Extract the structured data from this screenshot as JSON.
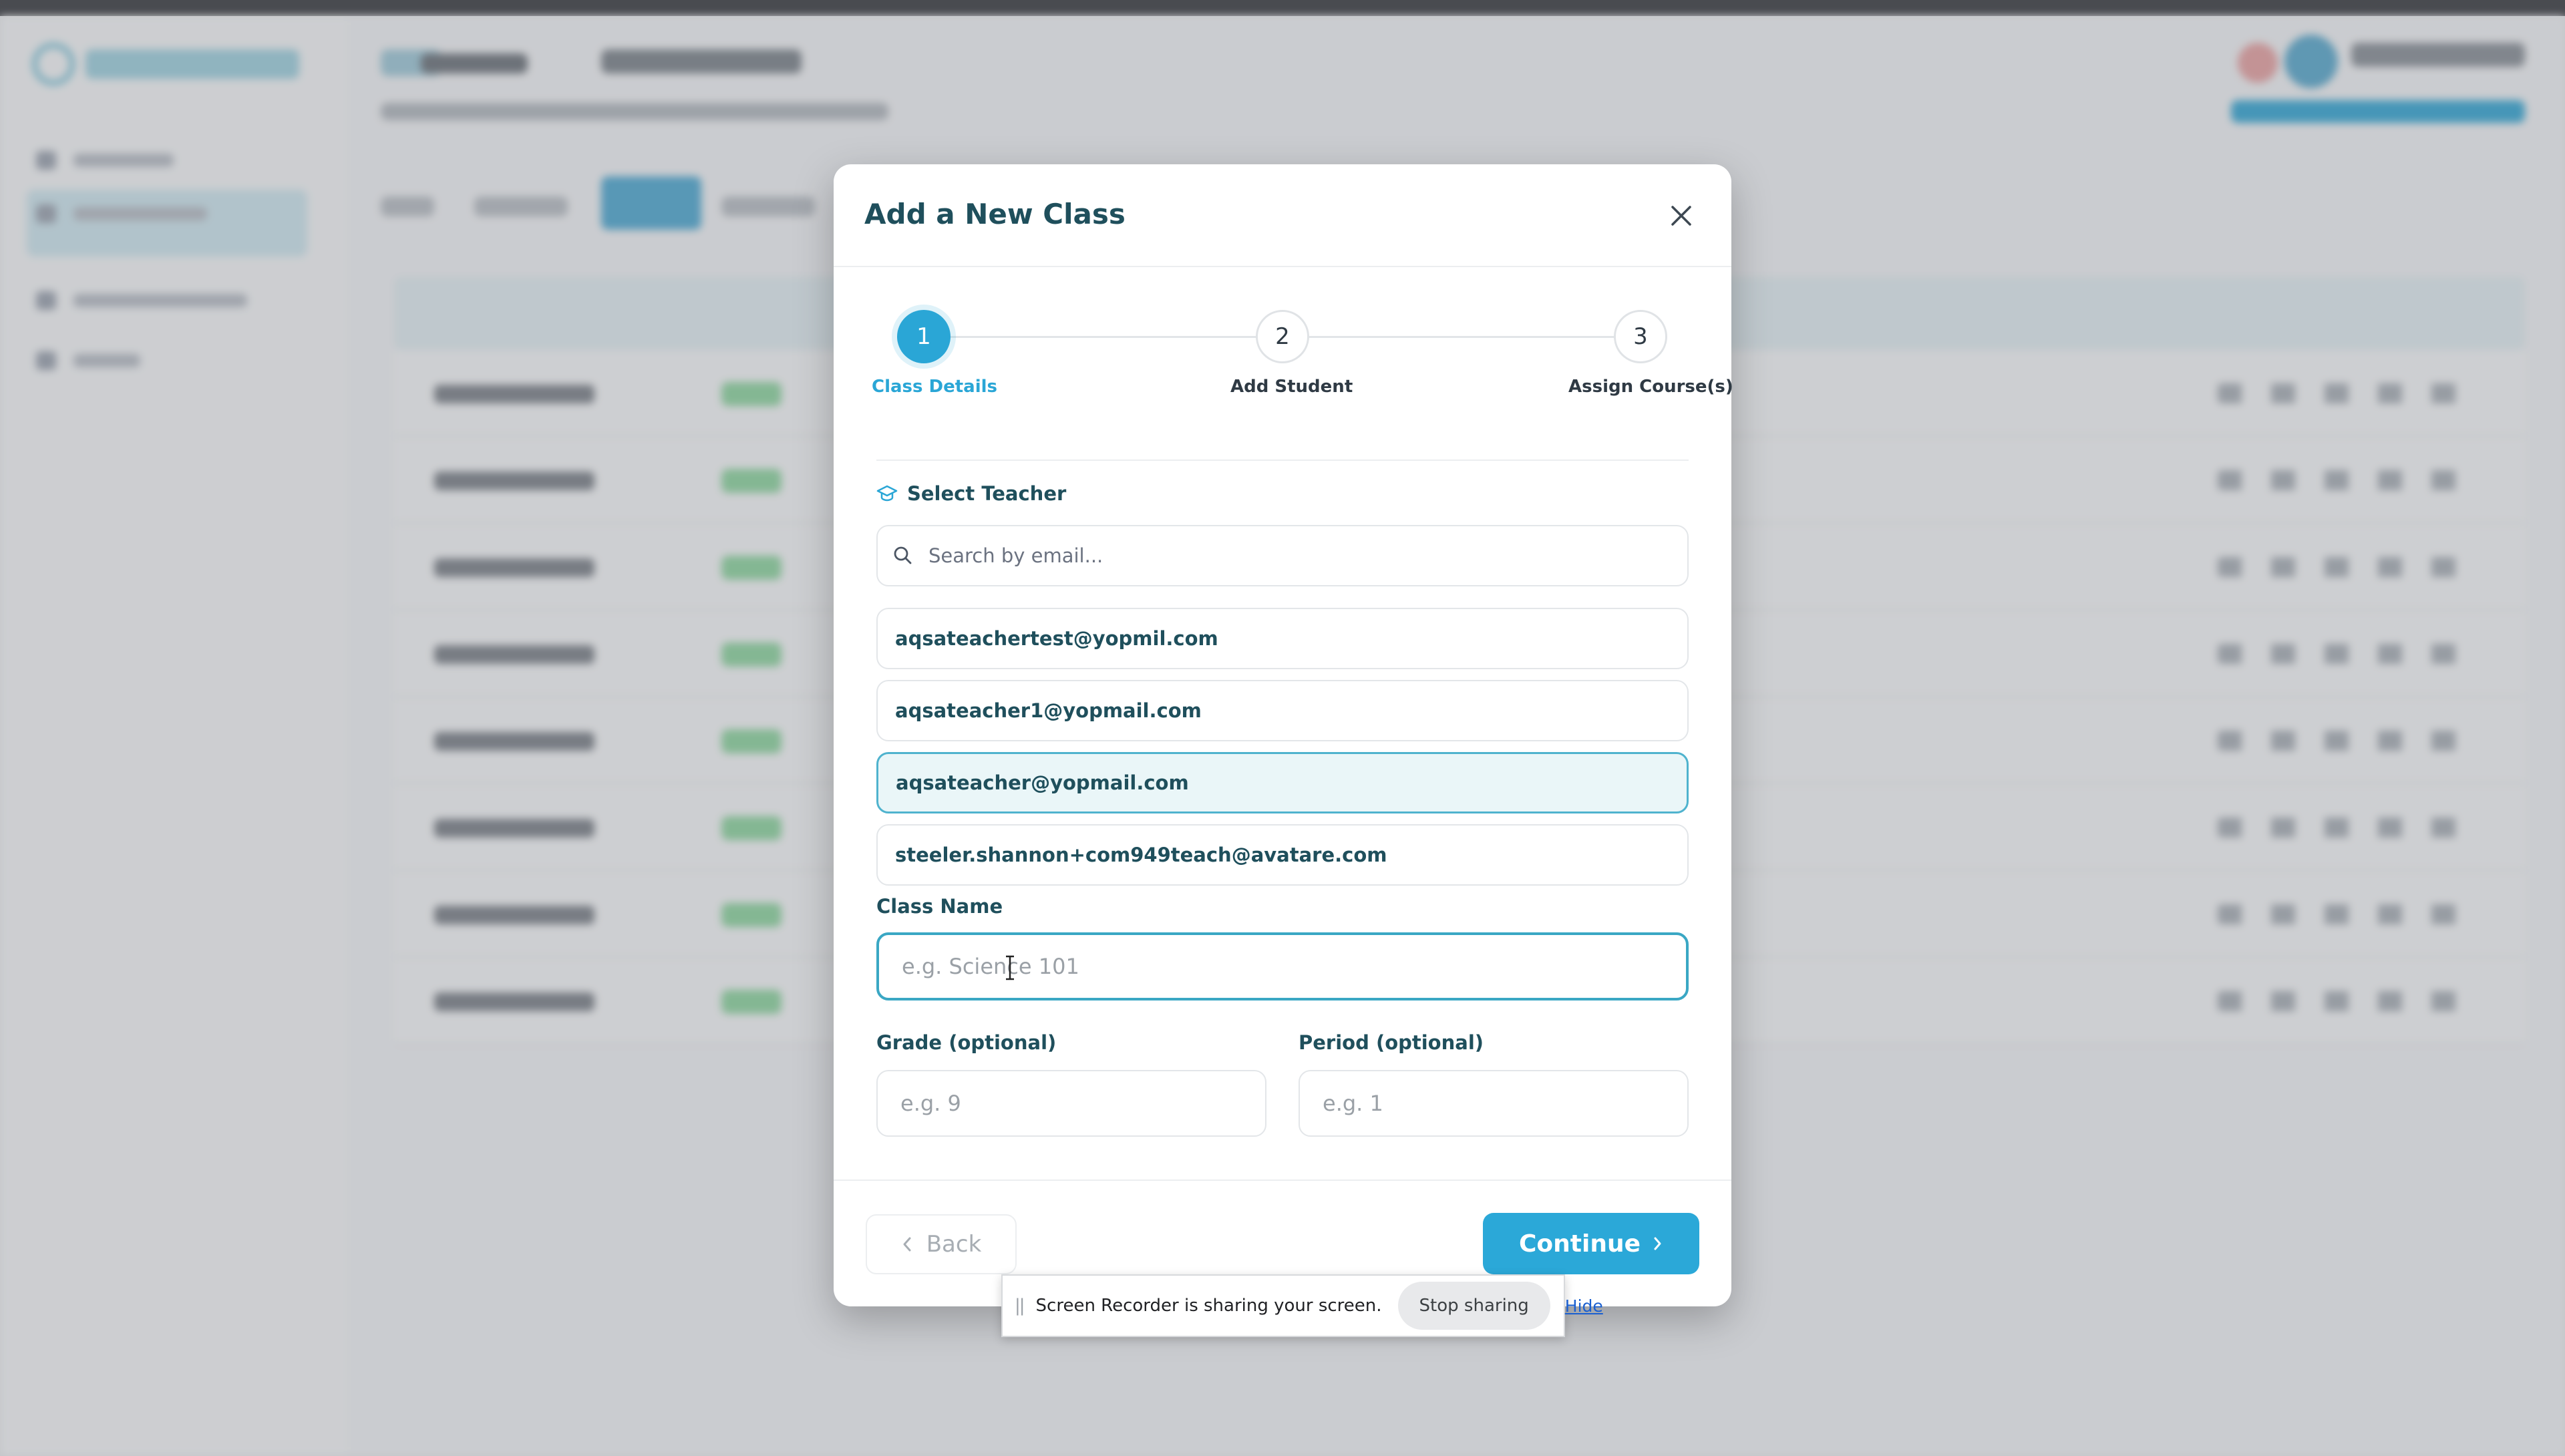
{
  "modal": {
    "title": "Add a New Class",
    "steps": [
      {
        "number": "1",
        "label": "Class Details",
        "state": "active"
      },
      {
        "number": "2",
        "label": "Add Student",
        "state": "inactive"
      },
      {
        "number": "3",
        "label": "Assign Course(s)",
        "state": "inactive"
      }
    ],
    "teacher_section": {
      "label": "Select Teacher",
      "search_placeholder": "Search by email...",
      "teachers": [
        {
          "email": "aqsateachertest@yopmil.com",
          "selected": false
        },
        {
          "email": "aqsateacher1@yopmail.com",
          "selected": false
        },
        {
          "email": "aqsateacher@yopmail.com",
          "selected": true
        },
        {
          "email": "steeler.shannon+com949teach@avatare.com",
          "selected": false
        }
      ]
    },
    "class_name": {
      "label": "Class Name",
      "placeholder": "e.g. Science 101",
      "value": ""
    },
    "grade": {
      "label": "Grade (optional)",
      "placeholder": "e.g. 9",
      "value": ""
    },
    "period": {
      "label": "Period (optional)",
      "placeholder": "e.g. 1",
      "value": ""
    },
    "back_label": "Back",
    "continue_label": "Continue"
  },
  "share_bar": {
    "message": "Screen Recorder is sharing your screen.",
    "stop_label": "Stop sharing",
    "hide_label": "Hide"
  },
  "colors": {
    "accent": "#2aa6d6",
    "heading": "#1f4f5c",
    "selected_bg": "#eaf6f8",
    "overlay": "#6e7076"
  },
  "icons": [
    "close-icon",
    "graduation-cap-icon",
    "search-icon",
    "chevron-left-icon",
    "chevron-right-icon",
    "text-cursor-icon",
    "drag-handle-icon"
  ]
}
